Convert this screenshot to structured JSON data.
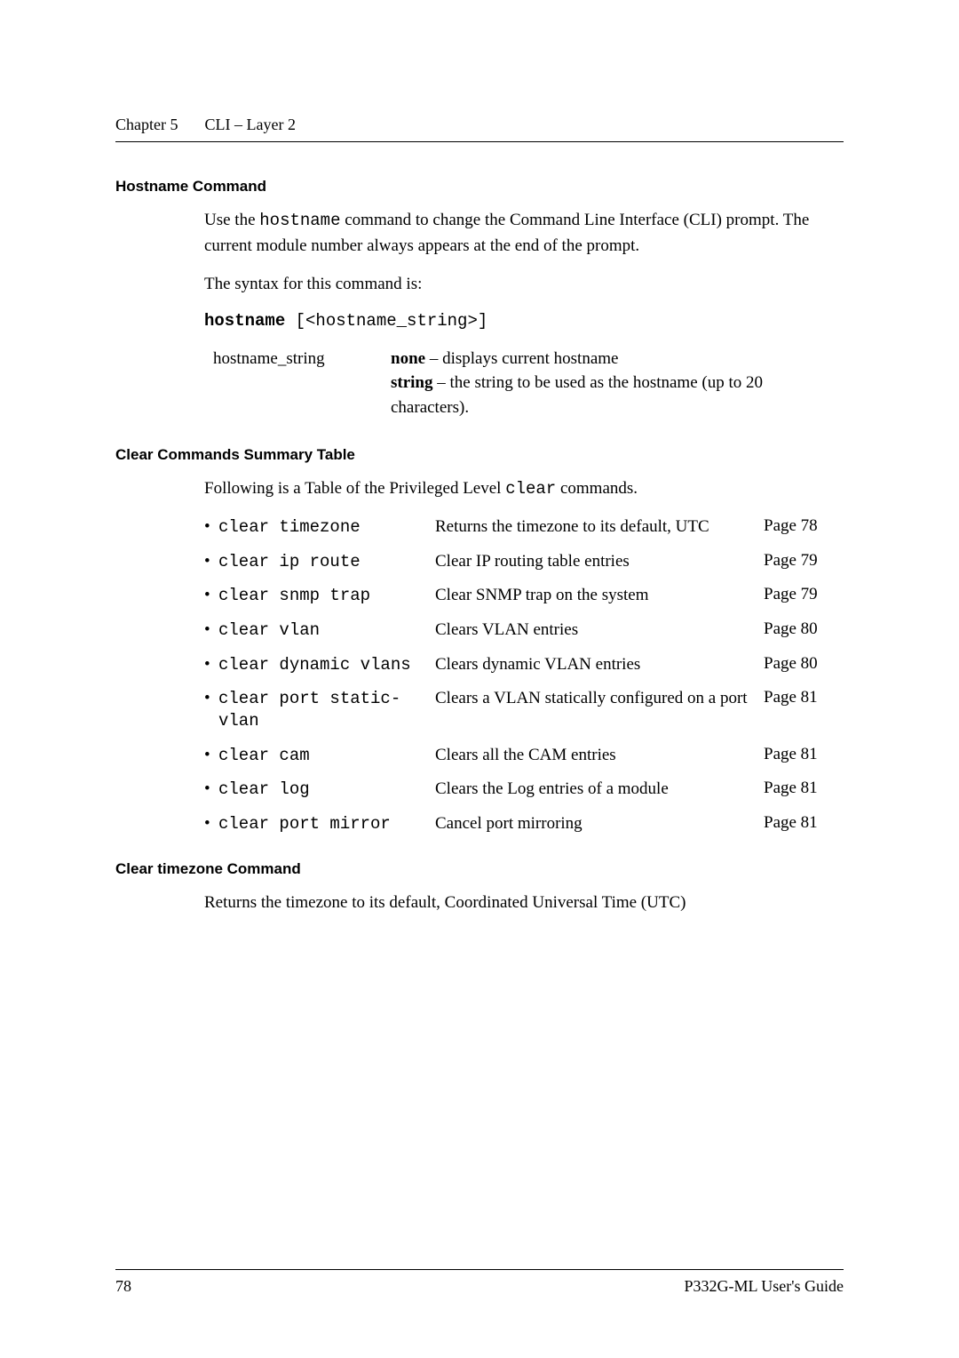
{
  "header": {
    "chapter": "Chapter 5",
    "title": "CLI – Layer 2"
  },
  "hostname_section": {
    "heading": "Hostname Command",
    "para1_pre": "Use the ",
    "para1_code": "hostname",
    "para1_post": " command to change the Command Line Interface (CLI) prompt. The current module number always appears at the end of the prompt.",
    "para2": "The syntax for this command is:",
    "syntax_bold": "hostname",
    "syntax_rest": " [<hostname_string>]",
    "param_name": "hostname_string",
    "param_none": "none",
    "param_none_desc": " – displays current hostname",
    "param_string": "string",
    "param_string_desc": " – the string to be used as the hostname (up to 20 characters)."
  },
  "clear_summary": {
    "heading": "Clear Commands Summary Table",
    "intro_pre": "Following is a Table of the Privileged Level ",
    "intro_code": "clear",
    "intro_post": " commands.",
    "rows": [
      {
        "cmd": "clear timezone",
        "desc": "Returns the timezone to its default, UTC",
        "page": "Page 78"
      },
      {
        "cmd": "clear ip route",
        "desc": "Clear IP routing table entries",
        "page": "Page 79"
      },
      {
        "cmd": "clear snmp trap",
        "desc": "Clear SNMP trap on the system",
        "page": "Page 79"
      },
      {
        "cmd": "clear vlan",
        "desc": "Clears VLAN entries",
        "page": "Page 80"
      },
      {
        "cmd": "clear dynamic vlans",
        "desc": "Clears dynamic VLAN entries",
        "page": "Page 80"
      },
      {
        "cmd": "clear port static-vlan",
        "desc": "Clears a VLAN statically configured on a port",
        "page": "Page 81"
      },
      {
        "cmd": "clear cam",
        "desc": "Clears all the CAM entries",
        "page": "Page 81"
      },
      {
        "cmd": "clear log",
        "desc": "Clears the Log entries of a module",
        "page": "Page 81"
      },
      {
        "cmd": "clear port mirror",
        "desc": "Cancel port mirroring",
        "page": "Page 81"
      }
    ]
  },
  "clear_timezone": {
    "heading": "Clear timezone Command",
    "body": "Returns the timezone to its default, Coordinated Universal Time (UTC)"
  },
  "footer": {
    "page_no": "78",
    "doc_title": "P332G-ML User's Guide"
  }
}
